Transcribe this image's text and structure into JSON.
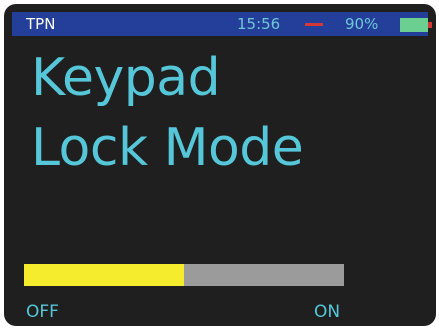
{
  "status": {
    "app_name": "TPN",
    "time": "15:56",
    "battery_percent_text": "90%",
    "battery_level": 0.9,
    "accent_color": "#6fc7d6",
    "alert_color": "#d43737",
    "bar_color": "#243f99"
  },
  "screen": {
    "title_line1": "Keypad",
    "title_line2": "Lock Mode",
    "title_color": "#55c7d8"
  },
  "toggle": {
    "off_label": "OFF",
    "on_label": "ON",
    "position_fraction": 0.5,
    "fill_color": "#f5ec2e",
    "track_color": "#9b9b9b"
  }
}
